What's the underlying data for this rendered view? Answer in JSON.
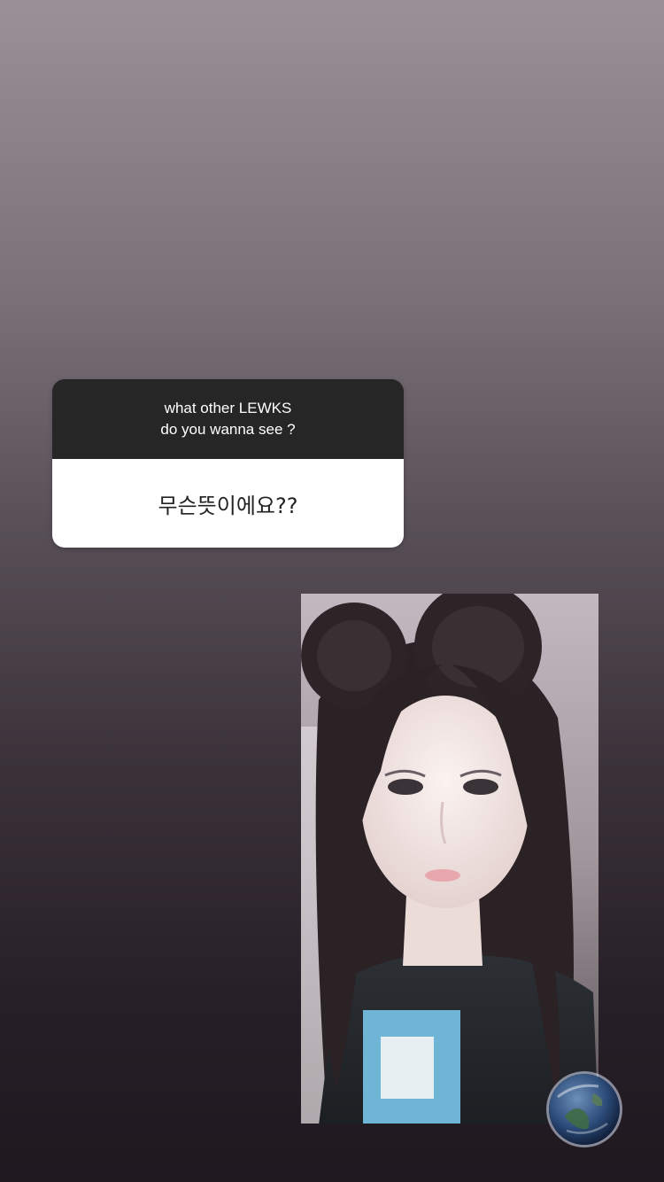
{
  "question_sticker": {
    "prompt": "what other LEWKS\ndo you wanna see ?",
    "answer": "무슨뜻이에요??"
  },
  "video_clip": {
    "subject": "selfie-video"
  },
  "globe_sticker": {
    "icon": "earth-globe-icon"
  },
  "colors": {
    "card_header": "#262626",
    "card_body": "#ffffff",
    "bg_top": "#9a9098",
    "bg_bottom": "#1f181f"
  }
}
